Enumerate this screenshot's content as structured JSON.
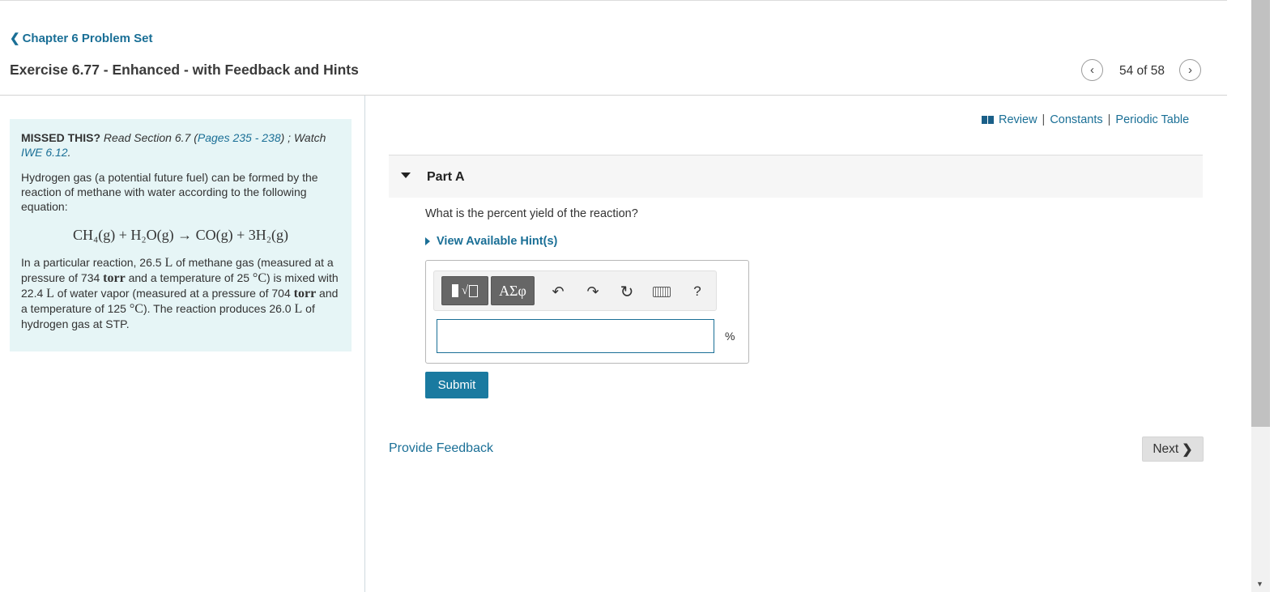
{
  "header": {
    "back_chevron": "❮",
    "back_label": "Chapter 6 Problem Set",
    "exercise_title": "Exercise 6.77 - Enhanced - with Feedback and Hints",
    "prev_icon": "‹",
    "next_icon": "›",
    "page_counter": "54 of 58"
  },
  "problem": {
    "missed_label": "MISSED THIS?",
    "read_text": " Read Section 6.7 (",
    "pages_link": "Pages 235 - 238",
    "watch_text": ") ; Watch ",
    "iwe_link": "IWE 6.12",
    "period": ".",
    "intro": "Hydrogen gas (a potential future fuel) can be formed by the reaction of methane with water according to the following equation:",
    "equation": "CH₄(g) + H₂O(g) → CO(g) + 3H₂(g)",
    "p1": "In a particular reaction, 26.5 ",
    "u_L": "L",
    "p2": " of methane gas (measured at a pressure of 734 ",
    "u_torr": "torr",
    "p3": " and a temperature of 25 ",
    "u_degC": "°C",
    "p4": ") is mixed with 22.4 ",
    "p5": " of water vapor (measured at a pressure of 704 ",
    "p6": " and a temperature of 125 ",
    "p7": "). The reaction produces 26.0 ",
    "p8": " of hydrogen gas at STP."
  },
  "resources": {
    "review": "Review",
    "constants": "Constants",
    "periodic_table": "Periodic Table",
    "separator": "|"
  },
  "part": {
    "label": "Part A",
    "question": "What is the percent yield of the reaction?",
    "hint_label": "View Available Hint(s)"
  },
  "toolbar": {
    "template_icon": "√",
    "symbols_label": "ΑΣφ",
    "undo_icon": "↶",
    "redo_icon": "↷",
    "reset_icon": "↻",
    "help_label": "?"
  },
  "answer": {
    "value": "",
    "placeholder": "",
    "unit": "%"
  },
  "actions": {
    "submit_label": "Submit",
    "feedback_label": "Provide Feedback",
    "next_label": "Next",
    "next_chevron": "❯"
  }
}
